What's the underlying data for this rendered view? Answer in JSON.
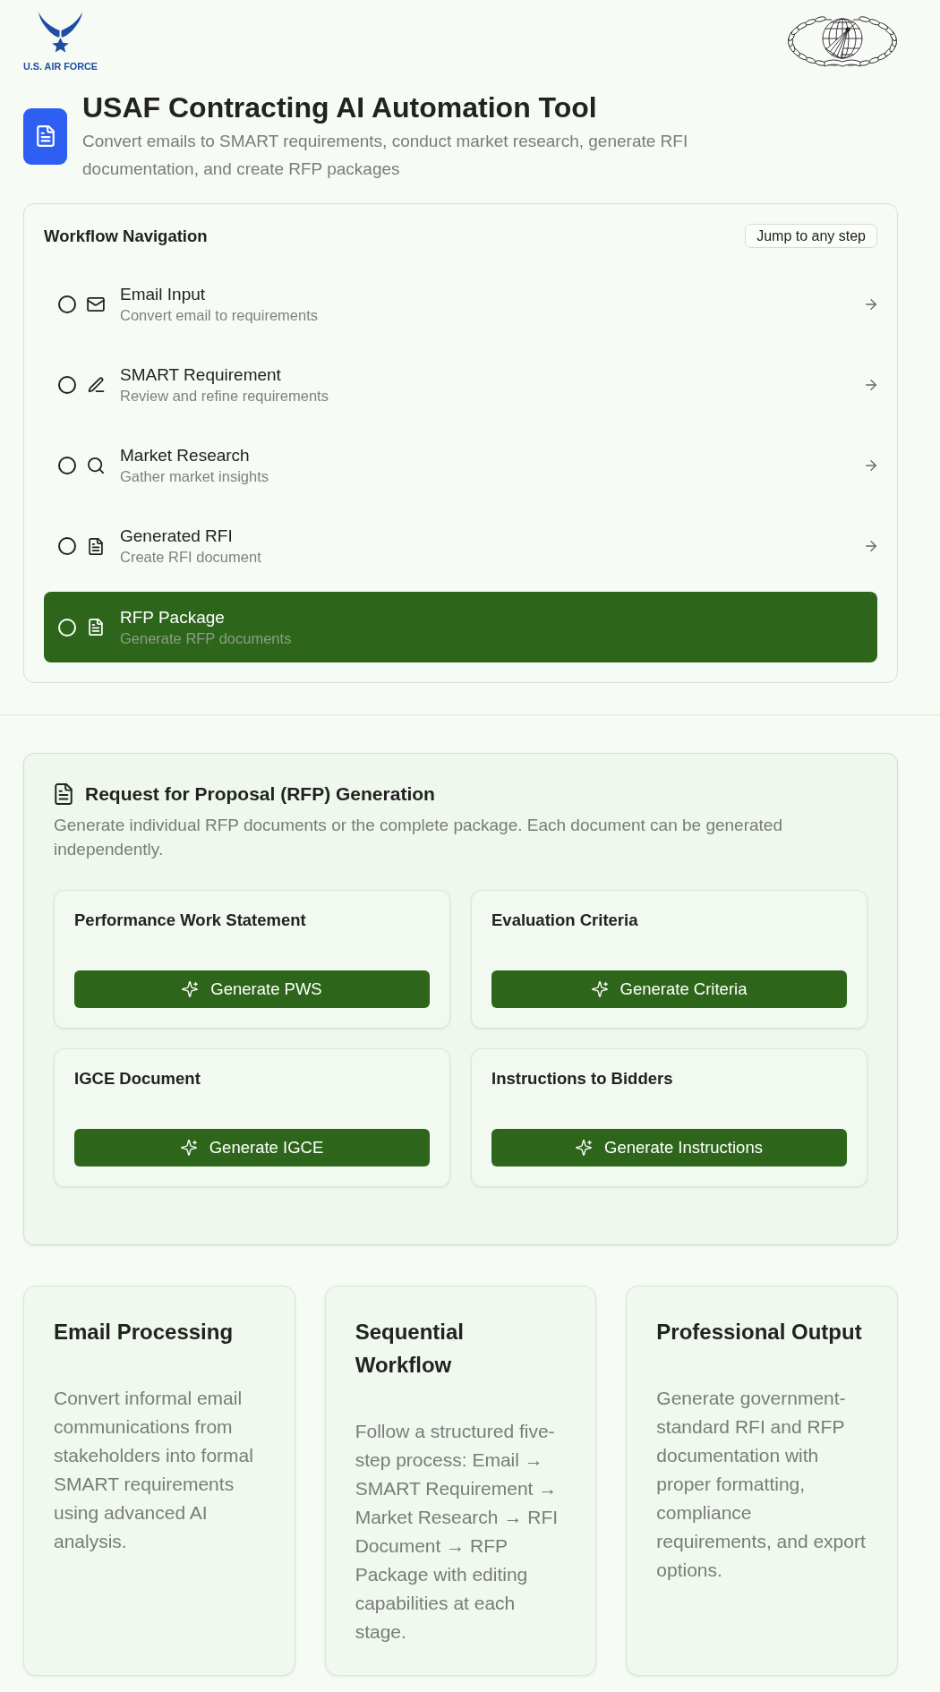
{
  "header": {
    "logo_text": "U.S. AIR FORCE",
    "title": "USAF Contracting AI Automation Tool",
    "subtitle": "Convert emails to SMART requirements, conduct market research, generate RFI documentation, and create RFP packages"
  },
  "workflow": {
    "title": "Workflow Navigation",
    "badge": "Jump to any step",
    "steps": [
      {
        "kind": "email",
        "label": "Email Input",
        "description": "Convert email to requirements",
        "selected": false
      },
      {
        "kind": "edit",
        "label": "SMART Requirement",
        "description": "Review and refine requirements",
        "selected": false
      },
      {
        "kind": "search",
        "label": "Market Research",
        "description": "Gather market insights",
        "selected": false
      },
      {
        "kind": "document",
        "label": "Generated RFI",
        "description": "Create RFI document",
        "selected": false
      },
      {
        "kind": "document",
        "label": "RFP Package",
        "description": "Generate RFP documents",
        "selected": true
      }
    ]
  },
  "rfp": {
    "title": "Request for Proposal (RFP) Generation",
    "description": "Generate individual RFP documents or the complete package. Each document can be generated independently.",
    "documents": [
      {
        "title": "Performance Work Statement",
        "button": "Generate PWS"
      },
      {
        "title": "Evaluation Criteria",
        "button": "Generate Criteria"
      },
      {
        "title": "IGCE Document",
        "button": "Generate IGCE"
      },
      {
        "title": "Instructions to Bidders",
        "button": "Generate Instructions"
      }
    ]
  },
  "features": [
    {
      "title": "Email Processing",
      "description": "Convert informal email communications from stakeholders into formal SMART requirements using advanced AI analysis."
    },
    {
      "title": "Sequential Workflow",
      "description": "Follow a structured five-step process: Email → SMART Requirement → Market Research → RFI Document → RFP Package with editing capabilities at each stage."
    },
    {
      "title": "Professional Output",
      "description": "Generate government-standard RFI and RFP documentation with proper formatting, compliance requirements, and export options."
    }
  ]
}
